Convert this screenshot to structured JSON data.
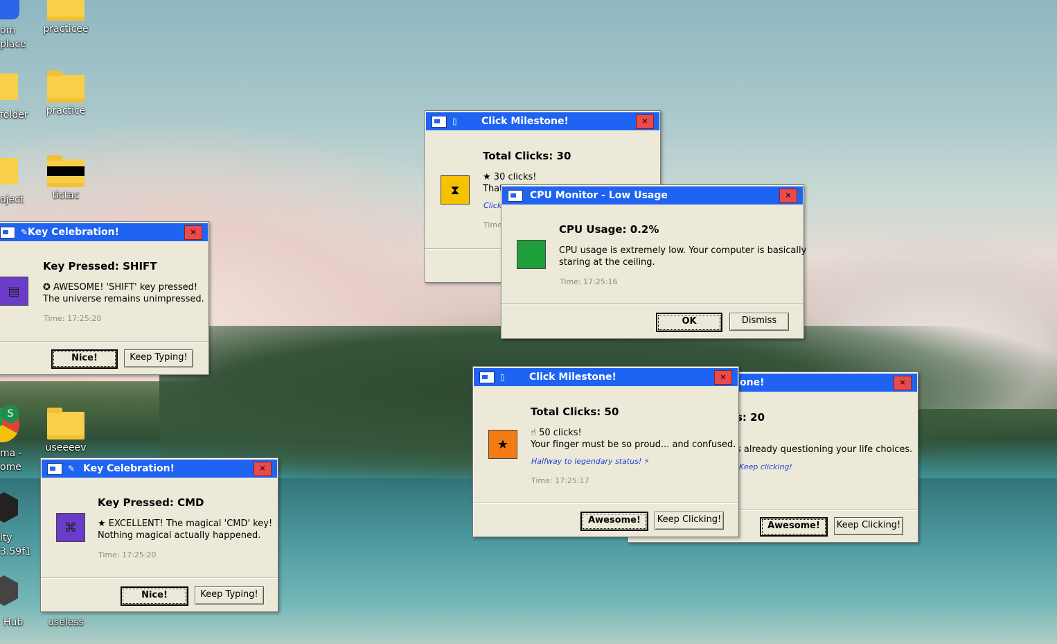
{
  "desktop": {
    "icons": [
      {
        "label": "practicee"
      },
      {
        "label": "practice"
      },
      {
        "label": "tictac"
      },
      {
        "label": "useeeev"
      },
      {
        "label": "useless"
      }
    ],
    "partial_labels": [
      "om",
      "place",
      "folder",
      "oject",
      "ma -",
      "ome",
      "ity",
      "3.59f1",
      "Hub"
    ]
  },
  "windows": {
    "click30": {
      "title": "Click Milestone!",
      "heading": "Total Clicks: 30",
      "line1": "30 clicks!",
      "line2": "That",
      "italic": "Click",
      "time": "Time"
    },
    "cpu": {
      "title": "CPU Monitor - Low Usage",
      "heading": "CPU Usage: 0.2%",
      "line1": "CPU usage is extremely low. Your computer is basically",
      "line2": "staring at the ceiling.",
      "time": "Time: 17:25:16",
      "ok": "OK",
      "dismiss": "Dismiss"
    },
    "key_shift": {
      "title": "Key Celebration!",
      "heading": "Key Pressed: SHIFT",
      "line1": "AWESOME! 'SHIFT' key pressed!",
      "line2": "The universe remains unimpressed.",
      "time": "Time: 17:25:20",
      "nice": "Nice!",
      "keep": "Keep Typing!"
    },
    "click20": {
      "title_partial": "one!",
      "heading_partial": "s: 20",
      "line_partial": "s already questioning your life choices.",
      "italic_partial": "Keep clicking!",
      "awesome": "Awesome!",
      "keep": "Keep Clicking!"
    },
    "click50": {
      "title": "Click Milestone!",
      "heading": "Total Clicks: 50",
      "line1": "50 clicks!",
      "line2": "Your finger must be so proud... and confused.",
      "italic": "Halfway to legendary status!",
      "time": "Time: 17:25:17",
      "awesome": "Awesome!",
      "keep": "Keep Clicking!"
    },
    "key_cmd": {
      "title": "Key Celebration!",
      "heading": "Key Pressed: CMD",
      "line1": "EXCELLENT! The magical 'CMD' key!",
      "line2": "Nothing magical actually happened.",
      "time": "Time: 17:25:20",
      "nice": "Nice!",
      "keep": "Keep Typing!"
    }
  },
  "colors": {
    "titlebar": "#1f63f2",
    "close": "#e84b4b",
    "dialog_bg": "#ece9d8",
    "icon_yellow": "#f5c200",
    "icon_green": "#1f9e3a",
    "icon_purple": "#6a3cc9",
    "icon_orange": "#f47b14"
  },
  "close_glyph": "×"
}
